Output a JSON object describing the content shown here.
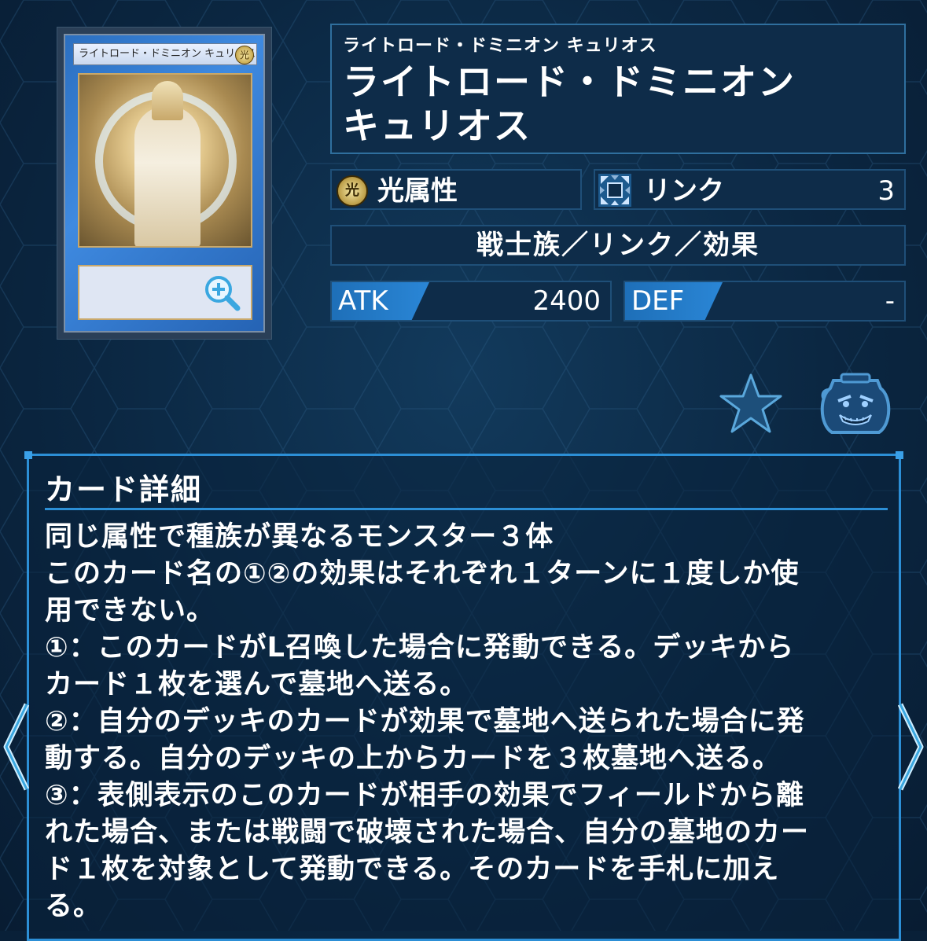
{
  "card": {
    "thumb_name": "ライトロード・ドミニオン キュリオス",
    "thumb_attr_glyph": "光"
  },
  "name_panel": {
    "ruby": "ライトロード・ドミニオン キュリオス",
    "name_line1": "ライトロード・ドミニオン",
    "name_line2": "キュリオス"
  },
  "attribute": {
    "glyph": "光",
    "label": "光属性"
  },
  "link": {
    "label": "リンク",
    "value": "3"
  },
  "type_line": "戦士族／リンク／効果",
  "stats": {
    "atk_label": "ATK",
    "atk_value": "2400",
    "def_label": "DEF",
    "def_value": "-"
  },
  "detail": {
    "heading": "カード詳細",
    "lines": [
      "同じ属性で種族が異なるモンスター３体",
      "このカード名の①②の効果はそれぞれ１ターンに１度しか使",
      "用できない。",
      "①：このカードがL召喚した場合に発動できる。デッキから",
      "カード１枚を選んで墓地へ送る。",
      "②：自分のデッキのカードが効果で墓地へ送られた場合に発",
      "動する。自分のデッキの上からカードを３枚墓地へ送る。",
      "③：表側表示のこのカードが相手の効果でフィールドから離",
      "れた場合、または戦闘で破壊された場合、自分の墓地のカー",
      "ド１枚を対象として発動できる。そのカードを手札に加え",
      "る。"
    ]
  },
  "icons": {
    "zoom": "zoom-in-icon",
    "favorite": "star-icon",
    "pot": "pot-of-greed-icon",
    "prev": "chevron-left-icon",
    "next": "chevron-right-icon"
  },
  "colors": {
    "background": "#0b2742",
    "panel": "#0e2c49",
    "accent": "#2c8fd6",
    "stat_tag": "#1e6fb8"
  }
}
